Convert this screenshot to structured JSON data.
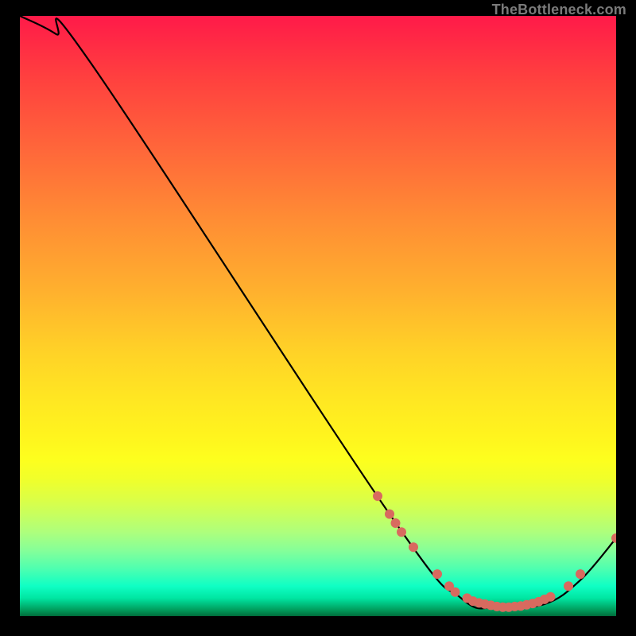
{
  "watermark": "TheBottleneck.com",
  "chart_data": {
    "type": "line",
    "title": "",
    "xlabel": "",
    "ylabel": "",
    "xlim": [
      0,
      100
    ],
    "ylim": [
      0,
      100
    ],
    "curve": [
      {
        "x": 0,
        "y": 100
      },
      {
        "x": 6,
        "y": 97
      },
      {
        "x": 12,
        "y": 92
      },
      {
        "x": 62,
        "y": 17
      },
      {
        "x": 74,
        "y": 3
      },
      {
        "x": 80,
        "y": 1.5
      },
      {
        "x": 88,
        "y": 2
      },
      {
        "x": 94,
        "y": 6
      },
      {
        "x": 100,
        "y": 13
      }
    ],
    "markers": [
      {
        "x": 60,
        "y": 20
      },
      {
        "x": 62,
        "y": 17
      },
      {
        "x": 63,
        "y": 15.5
      },
      {
        "x": 64,
        "y": 14
      },
      {
        "x": 66,
        "y": 11.5
      },
      {
        "x": 70,
        "y": 7
      },
      {
        "x": 72,
        "y": 5
      },
      {
        "x": 73,
        "y": 4
      },
      {
        "x": 75,
        "y": 3
      },
      {
        "x": 76,
        "y": 2.5
      },
      {
        "x": 77,
        "y": 2.2
      },
      {
        "x": 78,
        "y": 2
      },
      {
        "x": 79,
        "y": 1.8
      },
      {
        "x": 80,
        "y": 1.6
      },
      {
        "x": 81,
        "y": 1.5
      },
      {
        "x": 82,
        "y": 1.5
      },
      {
        "x": 83,
        "y": 1.6
      },
      {
        "x": 84,
        "y": 1.7
      },
      {
        "x": 85,
        "y": 1.9
      },
      {
        "x": 86,
        "y": 2.1
      },
      {
        "x": 87,
        "y": 2.4
      },
      {
        "x": 88,
        "y": 2.8
      },
      {
        "x": 89,
        "y": 3.2
      },
      {
        "x": 92,
        "y": 5
      },
      {
        "x": 94,
        "y": 7
      },
      {
        "x": 100,
        "y": 13
      }
    ],
    "marker_color": "#d86a5f",
    "line_color": "#000000",
    "gradient_stops": [
      {
        "pos": 0.0,
        "color": "#ff1a49"
      },
      {
        "pos": 0.5,
        "color": "#ffc028"
      },
      {
        "pos": 0.72,
        "color": "#fff41e"
      },
      {
        "pos": 0.9,
        "color": "#55ffab"
      },
      {
        "pos": 1.0,
        "color": "#006c3b"
      }
    ]
  }
}
